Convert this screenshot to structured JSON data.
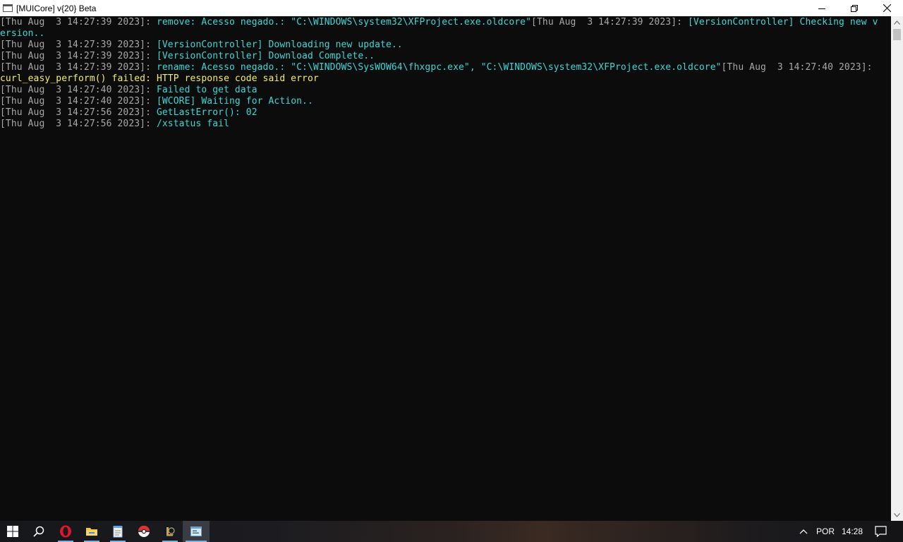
{
  "window": {
    "title": "[MUICore] v{20} Beta"
  },
  "console": {
    "lines": [
      {
        "parts": [
          {
            "t": "[Thu Aug  3 14:27:39 2023]: ",
            "c": "gray"
          },
          {
            "t": "remove: Acesso negado.: \"C:\\WINDOWS\\system32\\XFProject.exe.oldcore\"",
            "c": "cyan"
          },
          {
            "t": "[Thu Aug  3 14:27:39 2023]: ",
            "c": "gray"
          },
          {
            "t": "[VersionController] Checking new v",
            "c": "cyan"
          }
        ]
      },
      {
        "parts": [
          {
            "t": "ersion..",
            "c": "cyan"
          }
        ]
      },
      {
        "parts": [
          {
            "t": "[Thu Aug  3 14:27:39 2023]: ",
            "c": "gray"
          },
          {
            "t": "[VersionController] Downloading new update..",
            "c": "cyan"
          }
        ]
      },
      {
        "parts": [
          {
            "t": "[Thu Aug  3 14:27:39 2023]: ",
            "c": "gray"
          },
          {
            "t": "[VersionController] Download Complete..",
            "c": "cyan"
          }
        ]
      },
      {
        "parts": [
          {
            "t": "[Thu Aug  3 14:27:39 2023]: ",
            "c": "gray"
          },
          {
            "t": "rename: Acesso negado.: \"C:\\WINDOWS\\SysWOW64\\fhxgpc.exe\", \"C:\\WINDOWS\\system32\\XFProject.exe.oldcore\"",
            "c": "cyan"
          },
          {
            "t": "[Thu Aug  3 14:27:40 2023]:",
            "c": "gray"
          }
        ]
      },
      {
        "parts": [
          {
            "t": "curl_easy_perform() failed: HTTP response code said error",
            "c": "yellow"
          }
        ]
      },
      {
        "parts": [
          {
            "t": "[Thu Aug  3 14:27:40 2023]: ",
            "c": "gray"
          },
          {
            "t": "Failed to get data",
            "c": "cyan"
          }
        ]
      },
      {
        "parts": [
          {
            "t": "[Thu Aug  3 14:27:40 2023]: ",
            "c": "gray"
          },
          {
            "t": "[WCORE] Waiting for Action..",
            "c": "cyan"
          }
        ]
      },
      {
        "parts": [
          {
            "t": "[Thu Aug  3 14:27:56 2023]: ",
            "c": "gray"
          },
          {
            "t": "GetLastError(): 02",
            "c": "cyan"
          }
        ]
      },
      {
        "parts": [
          {
            "t": "[Thu Aug  3 14:27:56 2023]: ",
            "c": "gray"
          },
          {
            "t": "/xstatus fail",
            "c": "cyan"
          }
        ]
      }
    ]
  },
  "taskbar": {
    "language": "POR",
    "time": "14:28"
  },
  "colors": {
    "timestamp": "#a8a8a8",
    "message": "#3ad7d7",
    "error": "#f2f05f",
    "accent": "#7ab3e6"
  }
}
